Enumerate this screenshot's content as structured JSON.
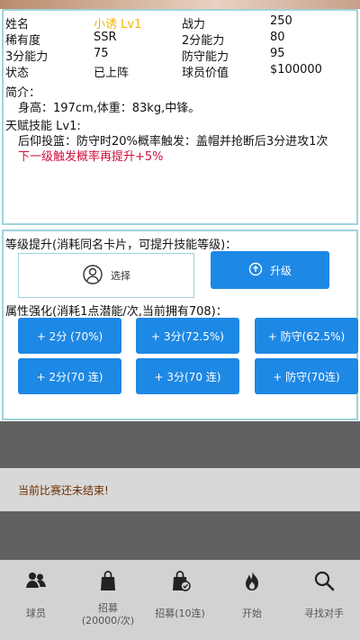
{
  "player": {
    "name_label": "姓名",
    "name_value": "小诱 Lv1",
    "power_label": "战力",
    "power_value": "250",
    "rarity_label": "稀有度",
    "rarity_value": "SSR",
    "two_point_label": "2分能力",
    "two_point_value": "80",
    "three_point_label": "3分能力",
    "three_point_value": "75",
    "defense_label": "防守能力",
    "defense_value": "95",
    "status_label": "状态",
    "status_value": "已上阵",
    "worth_label": "球员价值",
    "worth_value": "$100000",
    "intro_title": "简介：",
    "intro_text": "身高：197cm,体重：83kg,中锋。",
    "talent_title": "天赋技能 Lv1:",
    "talent_text": "后仰投篮：防守时20%概率触发：盖帽并抢断后3分进攻1次",
    "next_level_text": "下一级触发概率再提升+5%"
  },
  "upgrade": {
    "title": "等级提升(消耗同名卡片，可提升技能等级)：",
    "select_label": "选择",
    "upgrade_label": "升级"
  },
  "attributes": {
    "title": "属性强化(消耗1点潜能/次,当前拥有708)：",
    "buttons": [
      "+ 2分 (70%)",
      "+ 3分(72.5%)",
      "+ 防守(62.5%)",
      "+ 2分(70 连)",
      "+ 3分(70 连)",
      "+ 防守(70连)"
    ]
  },
  "notice": {
    "message": "当前比赛还未结束!"
  },
  "nav": {
    "items": [
      {
        "label": "球员",
        "icon": "players-icon"
      },
      {
        "label": "招募(20000/次)",
        "icon": "shopping-bag-icon"
      },
      {
        "label": "招募(10连)",
        "icon": "bag-check-icon"
      },
      {
        "label": "开始",
        "icon": "fire-icon"
      },
      {
        "label": "寻找对手",
        "icon": "search-icon"
      }
    ]
  }
}
